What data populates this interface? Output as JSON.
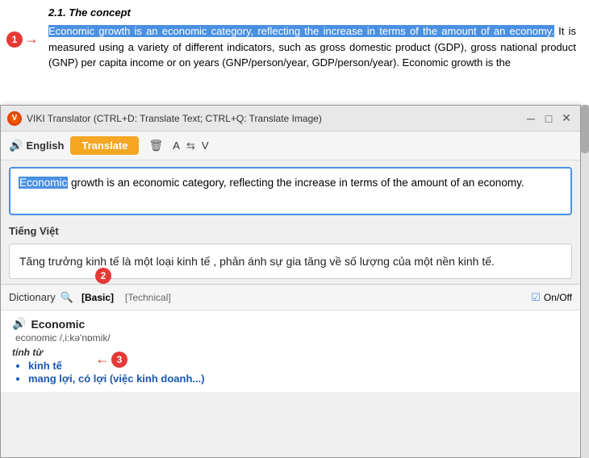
{
  "document": {
    "title": "2.1. The concept",
    "text_part1": "Economic growth is an economic category, reflecting the increase in terms of the amount of an economy.",
    "text_highlight": "Economic growth is an economic category, reflecting the increase in terms of the amount of an economy.",
    "text_rest": " It is measured using a variety of different indicators, such as gross domestic product (GDP), gross national product (GNP) per capita income or on years (GNP/person/year, GDP/person/year). Economic growth is the"
  },
  "translator_window": {
    "title": "VIKI Translator (CTRL+D: Translate Text; CTRL+Q: Translate Image)",
    "source_lang": "English",
    "translate_btn": "Translate",
    "delete_icon": "🗑",
    "swap_label": "A",
    "swap_icon": "V",
    "source_text_word": "Economic",
    "source_text_rest": " growth is an economic category, reflecting the increase in terms of the amount of an economy.",
    "target_lang_label": "Tiếng Việt",
    "translation_text": "Tăng trưởng kinh tế là một loại kinh tế , phản ánh sự gia tăng về số lượng của một nền kinh tế.",
    "dict_label": "Dictionary",
    "dict_tab1": "[Basic]",
    "dict_tab2": "[Technical]",
    "dict_onoff": "On/Off",
    "dict_word": "Economic",
    "dict_phonetic": "economic /,i:kə'nɒmik/",
    "dict_pos": "tính từ",
    "dict_meaning1": "kinh tế",
    "dict_meaning2": "mang lợi, có lợi (việc kinh doanh...)"
  },
  "annotations": {
    "num1": "1",
    "num2": "2",
    "num3": "3"
  }
}
